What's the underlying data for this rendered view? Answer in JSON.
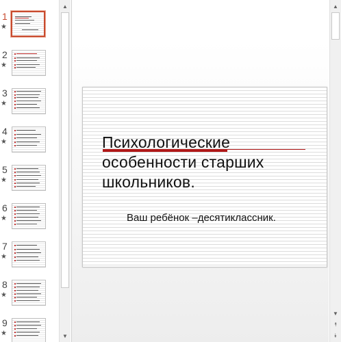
{
  "thumbnails": [
    {
      "number": "1",
      "active": true
    },
    {
      "number": "2",
      "active": false
    },
    {
      "number": "3",
      "active": false
    },
    {
      "number": "4",
      "active": false
    },
    {
      "number": "5",
      "active": false
    },
    {
      "number": "6",
      "active": false
    },
    {
      "number": "7",
      "active": false
    },
    {
      "number": "8",
      "active": false
    },
    {
      "number": "9",
      "active": false
    }
  ],
  "star_glyph": "★",
  "scroll_icons": {
    "up": "▲",
    "down": "▼",
    "prev_slide": "⯭",
    "next_slide": "⯯"
  },
  "slide": {
    "title_lines": [
      "Психологические",
      "особенности старших",
      "школьников."
    ],
    "subtitle": "Ваш ребёнок –десятиклассник."
  },
  "colors": {
    "active_accent": "#c84b2f",
    "title_rule": "#b01818",
    "bullet_red": "#c03030"
  }
}
